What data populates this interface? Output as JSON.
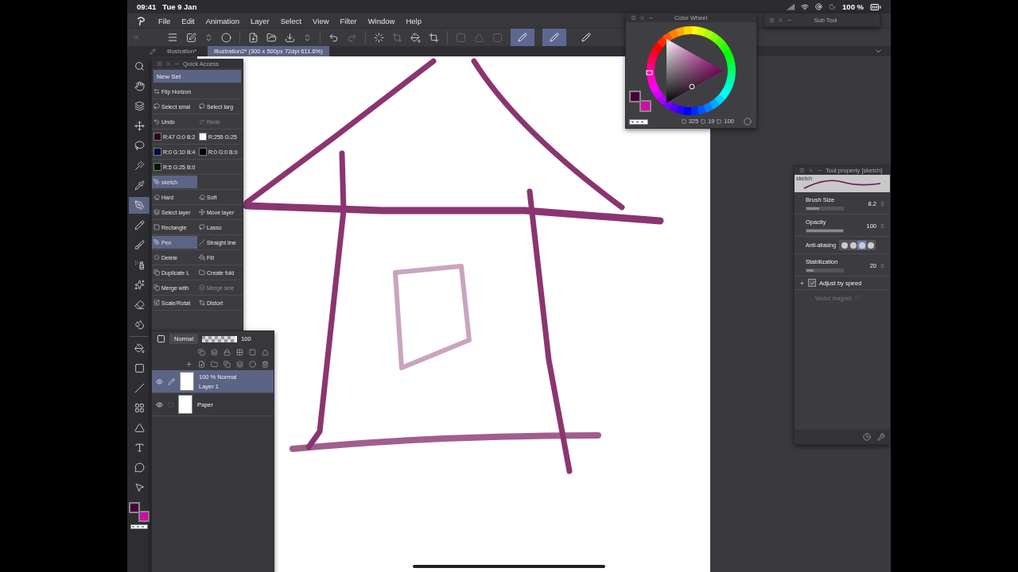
{
  "status_bar": {
    "time": "09:41",
    "date": "Tue 9 Jan",
    "battery": "100 %"
  },
  "menu": [
    "File",
    "Edit",
    "Animation",
    "Layer",
    "Select",
    "View",
    "Filter",
    "Window",
    "Help"
  ],
  "toolbar": {
    "toggles": [
      {
        "selected": true
      },
      {
        "selected": true
      },
      {
        "selected": false
      }
    ]
  },
  "tabs": [
    {
      "label": "Illustration*",
      "selected": false
    },
    {
      "label": "Illustration2* (300 x 500px 72dpi 611.6%)",
      "selected": true
    }
  ],
  "tools": [
    {
      "selected": false
    },
    {
      "selected": false
    },
    {
      "selected": false
    },
    {
      "selected": false
    },
    {
      "selected": false
    },
    {
      "selected": false
    },
    {
      "selected": false
    },
    {
      "selected": true
    },
    {
      "selected": false
    },
    {
      "selected": false
    },
    {
      "selected": false
    },
    {
      "selected": false
    },
    {
      "selected": false
    },
    {
      "selected": false
    },
    {
      "selected": false
    },
    {
      "selected": false
    },
    {
      "selected": false
    },
    {
      "selected": false
    },
    {
      "selected": false
    },
    {
      "selected": false
    },
    {
      "selected": false
    },
    {
      "selected": false
    }
  ],
  "tool_swatches": [
    {
      "color": "#4a0038"
    },
    {
      "color": "#d10ca8"
    }
  ],
  "color_wheel": {
    "title": "Color Wheel",
    "swatches": [
      {
        "color": "#4a0038"
      },
      {
        "color": "#d10ca8"
      }
    ],
    "readings": [
      "325",
      "19",
      "100"
    ]
  },
  "sub_tool": {
    "title": "Sub Tool"
  },
  "quick_access": {
    "title": "Quick Access",
    "set": "New Set",
    "rows": [
      [
        {
          "kind": "tool",
          "label": "Flip Horizon",
          "selected": false,
          "disabled": false
        }
      ],
      [
        {
          "kind": "tool",
          "label": "Select smal",
          "selected": false,
          "disabled": false
        },
        {
          "kind": "tool",
          "label": "Select larg",
          "selected": false,
          "disabled": false
        }
      ],
      [
        {
          "kind": "tool",
          "label": "Undo",
          "selected": false,
          "disabled": false
        },
        {
          "kind": "tool",
          "label": "Redo",
          "selected": false,
          "disabled": true
        }
      ],
      [
        {
          "kind": "color",
          "label": "R:47 G:0 B:2",
          "color": "#2f0020"
        },
        {
          "kind": "color",
          "label": "R:255 G:25",
          "color": "#ffffff"
        }
      ],
      [
        {
          "kind": "color",
          "label": "R:0 G:10 B:4",
          "color": "#000a40"
        },
        {
          "kind": "color",
          "label": "R:0 G:0 B:0",
          "color": "#000000"
        }
      ],
      [
        {
          "kind": "color",
          "label": "R:5 G:25 B:0",
          "color": "#051900"
        }
      ],
      [
        {
          "kind": "tool",
          "label": "sketch",
          "selected": true,
          "disabled": false
        }
      ],
      [
        {
          "kind": "tool",
          "label": "Hard",
          "selected": false,
          "disabled": false
        },
        {
          "kind": "tool",
          "label": "Soft",
          "selected": false,
          "disabled": false
        }
      ],
      [
        {
          "kind": "tool",
          "label": "Select layer",
          "selected": false,
          "disabled": false
        },
        {
          "kind": "tool",
          "label": "Move layer",
          "selected": false,
          "disabled": false
        }
      ],
      [
        {
          "kind": "tool",
          "label": "Rectangle",
          "selected": false,
          "disabled": false
        },
        {
          "kind": "tool",
          "label": "Lasso",
          "selected": false,
          "disabled": false
        }
      ],
      [
        {
          "kind": "tool",
          "label": "Pen",
          "selected": true,
          "disabled": false
        },
        {
          "kind": "tool",
          "label": "Straight line",
          "selected": false,
          "disabled": false
        }
      ],
      [
        {
          "kind": "tool",
          "label": "Delete",
          "selected": false,
          "disabled": false
        },
        {
          "kind": "tool",
          "label": "Fill",
          "selected": false,
          "disabled": false
        }
      ],
      [
        {
          "kind": "tool",
          "label": "Duplicate L",
          "selected": false,
          "disabled": false
        },
        {
          "kind": "tool",
          "label": "Create fold",
          "selected": false,
          "disabled": false
        }
      ],
      [
        {
          "kind": "tool",
          "label": "Merge with",
          "selected": false,
          "disabled": false
        },
        {
          "kind": "tool",
          "label": "Merge sele",
          "selected": false,
          "disabled": true
        }
      ],
      [
        {
          "kind": "tool",
          "label": "Scale/Rotat",
          "selected": false,
          "disabled": false
        },
        {
          "kind": "tool",
          "label": "Distort",
          "selected": false,
          "disabled": false
        }
      ]
    ]
  },
  "layers": {
    "blend": "Normal",
    "opacity": "100",
    "opacity_slider": {
      "level": 1
    },
    "items": [
      {
        "name": "Layer 1",
        "info": "100 % Normal",
        "selected": true,
        "visible": true
      },
      {
        "name": "Paper",
        "selected": false,
        "visible": true
      }
    ]
  },
  "tool_property": {
    "title": "Tool property [sketch]",
    "preview": "sketch",
    "items": [
      {
        "kind": "slider",
        "label": "Brush Size",
        "value": "8.2",
        "level": 0.35
      },
      {
        "kind": "slider",
        "label": "Opacity",
        "value": "100",
        "level": 1
      },
      {
        "kind": "choice",
        "label": "Anti-aliasing",
        "options": [
          {
            "selected": false
          },
          {
            "selected": false
          },
          {
            "selected": true
          },
          {
            "selected": false
          }
        ]
      },
      {
        "kind": "slider",
        "label": "Stabilization",
        "value": "20",
        "level": 0.2
      },
      {
        "kind": "checkbox",
        "label": "Adjust by speed",
        "checked": true
      },
      {
        "kind": "magnet",
        "label": "Vector magnet",
        "disabled": true
      }
    ]
  }
}
